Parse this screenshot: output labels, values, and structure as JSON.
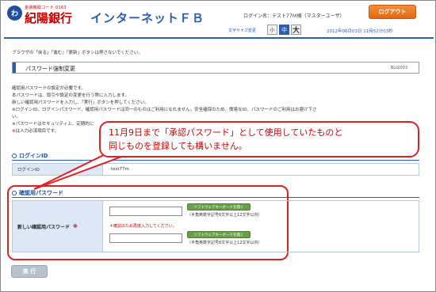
{
  "header": {
    "bank_code": "金融機関コード 0163",
    "logo_mark": "わ",
    "bank_name": "紀陽銀行",
    "service_title": "インターネットＦＢ",
    "login_name": "ログイン名：テスト77Ｍ様（マスターユーザ）",
    "logout_label": "ログアウト",
    "font_size_label": "文字サイズ変更",
    "font_sizes": [
      "小",
      "中",
      "大"
    ],
    "datetime": "2012年06月03日 11時52分03秒"
  },
  "browser_note": "ブラウザの「戻る」「進む」「更新」ボタンは押さないでください。",
  "page": {
    "title": "パスワード強制変更",
    "screen_id": "BLGI003"
  },
  "instructions": [
    "確認用パスワードの設定が必要です。",
    "本パスワードは、取引や設定の変更を行う際に入力します。",
    "新しい確認用パスワードを入力し、「実行」ボタンを押してください。",
    "※ログインID、ログインパスワード、確認用パスワードは同一のものはご利用になれません。安全確保のため、簡易なID、パスワードのご利用はお避け下さ",
    "い。",
    "※パスワードはセキュリティ上、定期的に"
  ],
  "required_note": "は入力必須項目です。",
  "required_mark": "※",
  "callout": {
    "text_line1": "11月9日まで「承認パスワード」として使用していたものと",
    "text_line2": "同じものを登録しても構いません。"
  },
  "login_section": {
    "heading": "ログインID",
    "label": "ログインID",
    "value": "test77m"
  },
  "confirm_section": {
    "heading": "確認用パスワード",
    "label": "新しい確認用パスワード",
    "required_mark": "※",
    "keyboard_button": "ソフトウェアキーボードを開く",
    "hint": "（半角英数字記号6文字以上12文字以内）",
    "reenter_note": "＊確認のため再度入力してください。"
  },
  "execute_label": "実 行"
}
